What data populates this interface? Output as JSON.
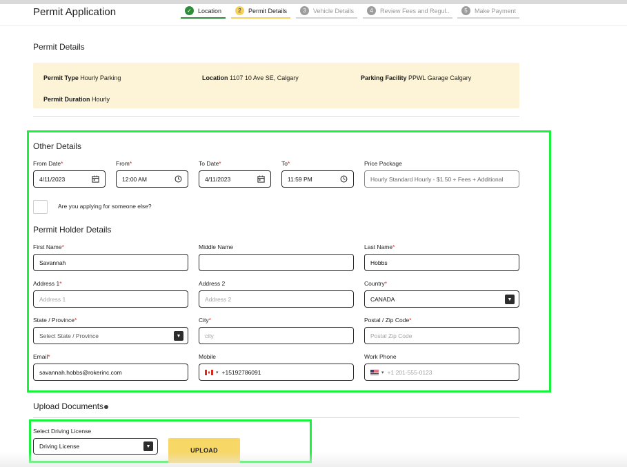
{
  "header": {
    "title": "Permit Application",
    "steps": [
      {
        "num": "✓",
        "label": "Location"
      },
      {
        "num": "2",
        "label": "Permit Details"
      },
      {
        "num": "3",
        "label": "Vehicle Details"
      },
      {
        "num": "4",
        "label": "Review Fees and Regul.."
      },
      {
        "num": "5",
        "label": "Make Payment"
      }
    ]
  },
  "permit_details": {
    "title": "Permit Details",
    "items": [
      {
        "key": "Permit Type",
        "value": "Hourly Parking"
      },
      {
        "key": "Location",
        "value": "1107 10 Ave SE, Calgary"
      },
      {
        "key": "Parking Facility",
        "value": "PPWL Garage Calgary"
      },
      {
        "key": "Permit Duration",
        "value": "Hourly"
      }
    ]
  },
  "other_details": {
    "title": "Other Details",
    "from_date": {
      "label": "From Date",
      "value": "4/11/2023"
    },
    "from": {
      "label": "From",
      "value": "12:00 AM"
    },
    "to_date": {
      "label": "To Date",
      "value": "4/11/2023"
    },
    "to": {
      "label": "To",
      "value": "11:59 PM"
    },
    "price_package": {
      "label": "Price Package",
      "value": "Hourly Standard Hourly - $1.50 + Fees + Additional"
    },
    "someone_else": "Are you applying for someone else?"
  },
  "holder": {
    "title": "Permit Holder Details",
    "first_name": {
      "label": "First Name",
      "value": "Savannah"
    },
    "middle_name": {
      "label": "Middle Name",
      "value": ""
    },
    "last_name": {
      "label": "Last Name",
      "value": "Hobbs"
    },
    "address1": {
      "label": "Address 1",
      "placeholder": "Address 1"
    },
    "address2": {
      "label": "Address 2",
      "placeholder": "Address 2"
    },
    "country": {
      "label": "Country",
      "value": "CANADA"
    },
    "state": {
      "label": "State / Province",
      "placeholder": "Select State / Province"
    },
    "city": {
      "label": "City",
      "placeholder": "city"
    },
    "postal": {
      "label": "Postal / Zip Code",
      "placeholder": "Postal Zip Code"
    },
    "email": {
      "label": "Email",
      "value": "savannah.hobbs@rokerinc.com"
    },
    "mobile": {
      "label": "Mobile",
      "value": "+15192786091"
    },
    "work_phone": {
      "label": "Work Phone",
      "placeholder": "+1 201-555-0123"
    }
  },
  "upload": {
    "title": "Upload Documents",
    "select_label": "Select Driving License",
    "select_value": "Driving License",
    "button": "UPLOAD"
  },
  "colors": {
    "highlight": "#19f23c",
    "accent": "#f7d766",
    "step_done": "#2e8b3a",
    "required": "#e0282e",
    "info_bg": "#fdf4d7"
  },
  "icons": [
    "check-icon",
    "calendar-icon",
    "clock-icon",
    "dropdown-arrow-icon",
    "canada-flag-icon",
    "us-flag-icon",
    "info-icon"
  ]
}
